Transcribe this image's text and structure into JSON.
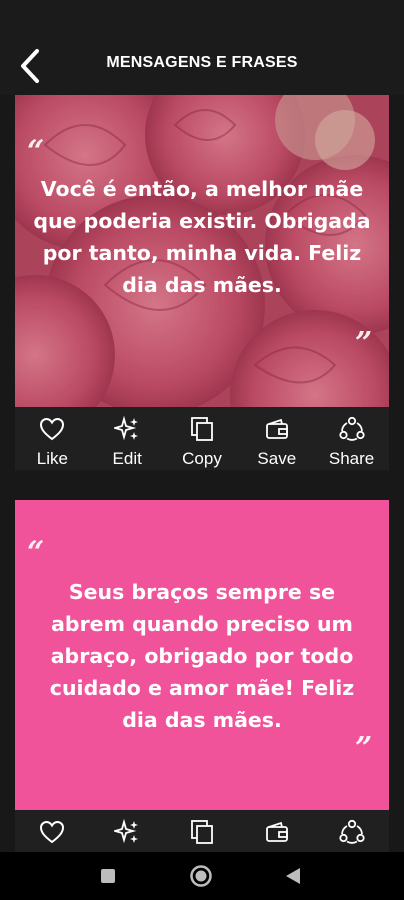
{
  "header": {
    "title": "MENSAGENS E FRASES",
    "back_icon": "chevron-left-icon"
  },
  "cards": [
    {
      "text": "Você é então, a melhor mãe que poderia existir. Obrigada por tanto, minha vida. Feliz dia das mães.",
      "background": "pink-roses-photo",
      "open_quote": "“",
      "close_quote": "”"
    },
    {
      "text": "Seus braços sempre se abrem quando preciso um abraço, obrigado por todo cuidado e amor mãe! Feliz dia das mães.",
      "background_color": "#f0539a",
      "open_quote": "“",
      "close_quote": "”"
    }
  ],
  "actions": [
    {
      "label": "Like",
      "icon": "heart-icon"
    },
    {
      "label": "Edit",
      "icon": "sparkles-icon"
    },
    {
      "label": "Copy",
      "icon": "copy-icon"
    },
    {
      "label": "Save",
      "icon": "wallet-icon"
    },
    {
      "label": "Share",
      "icon": "share-icon"
    }
  ],
  "colors": {
    "app_bar": "#1b1b1b",
    "background": "#181818",
    "action_bar": "#202020",
    "card2_pink": "#f0539a"
  },
  "system_nav": [
    "recents-icon",
    "home-icon",
    "back-icon"
  ]
}
